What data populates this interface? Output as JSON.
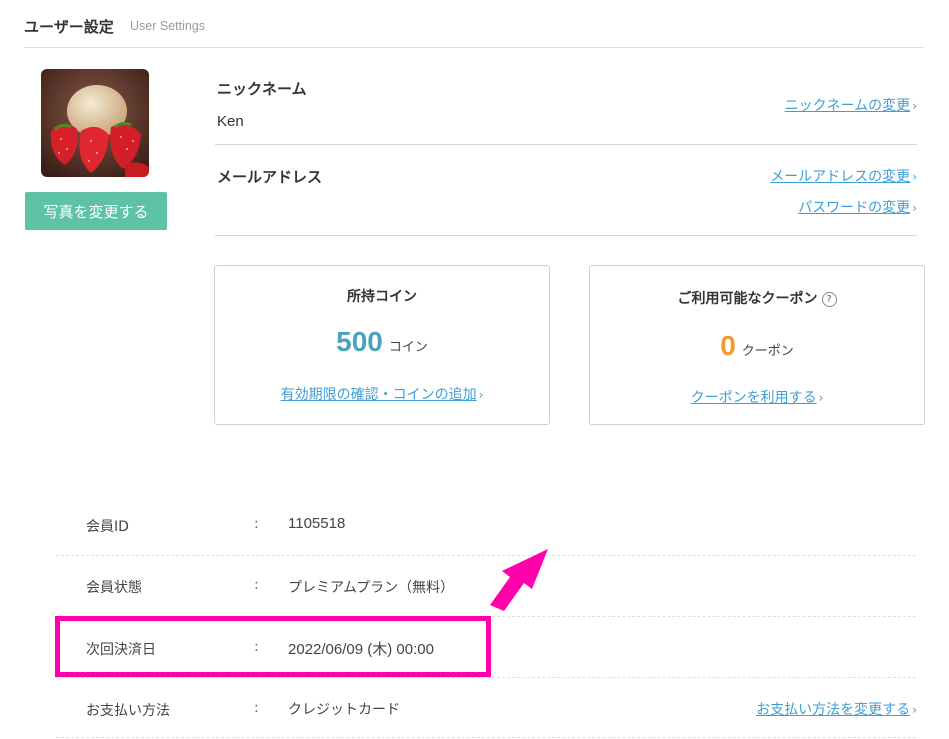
{
  "header": {
    "title": "ユーザー設定",
    "subtitle": "User Settings"
  },
  "profile": {
    "change_photo_label": "写真を変更する",
    "nickname_label": "ニックネーム",
    "nickname_value": "Ken",
    "nickname_change_link": "ニックネームの変更",
    "email_label": "メールアドレス",
    "email_change_link": "メールアドレスの変更",
    "password_change_link": "パスワードの変更"
  },
  "coins": {
    "title": "所持コイン",
    "amount": "500",
    "unit": "コイン",
    "link": "有効期限の確認・コインの追加"
  },
  "coupons": {
    "title": "ご利用可能なクーポン",
    "amount": "0",
    "unit": "クーポン",
    "link": "クーポンを利用する"
  },
  "info": {
    "colon": ":",
    "rows": [
      {
        "label": "会員ID",
        "value": "1105518"
      },
      {
        "label": "会員状態",
        "value": "プレミアムプラン（無料）"
      },
      {
        "label": "次回決済日",
        "value": "2022/06/09 (木) 00:00"
      },
      {
        "label": "お支払い方法",
        "value": "クレジットカード",
        "link": "お支払い方法を変更する"
      }
    ]
  },
  "colors": {
    "accent_green": "#5ec3a6",
    "link_blue": "#3d9fd6",
    "coin_color": "#4aa3b8",
    "coupon_color": "#f39a2b",
    "highlight_magenta": "#ff00aa"
  },
  "icons": {
    "chevron": "chevron-right-icon",
    "help": "question-circle-icon",
    "annotation": "arrow-icon"
  }
}
